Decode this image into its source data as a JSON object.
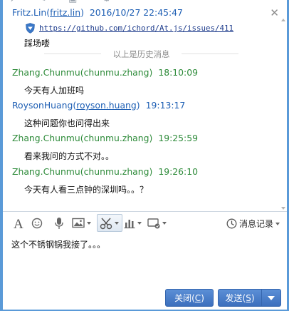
{
  "messages": [
    {
      "name": "Fritz.Lin",
      "open": "(",
      "handle": "fritz.lin",
      "close": ")",
      "time": "2016/10/27 22:45:47",
      "text": "踩场喽",
      "link": "https://github.com/ichord/At.js/issues/411",
      "color": "#1e5fb4"
    },
    {
      "name": "Zhang.Chunmu",
      "open": "(",
      "handle": "chunmu.zhang",
      "close": ")",
      "time": "18:10:09",
      "text": "今天有人加班吗",
      "color": "#2e8b3a"
    },
    {
      "name": "RoysonHuang",
      "open": "(",
      "handle": "royson.huang",
      "close": ")",
      "time": "19:13:17",
      "text": "这种问题你也问得出来",
      "color": "#1e5fb4"
    },
    {
      "name": "Zhang.Chunmu",
      "open": "(",
      "handle": "chunmu.zhang",
      "close": ")",
      "time": "19:25:59",
      "text": "看来我问的方式不对。。",
      "color": "#2e8b3a"
    },
    {
      "name": "Zhang.Chunmu",
      "open": "(",
      "handle": "chunmu.zhang",
      "close": ")",
      "time": "19:26:10",
      "text": "今天有人看三点钟的深圳吗。。？",
      "color": "#2e8b3a"
    }
  ],
  "history_divider": "以上是历史消息",
  "toolbar": {
    "history_label": "消息记录",
    "icons": [
      "font-icon",
      "emoji-icon",
      "voice-icon",
      "image-icon",
      "screenshot-icon",
      "chart-icon",
      "remote-icon"
    ]
  },
  "input": {
    "text": "这个不锈钢锅我接了。。。"
  },
  "buttons": {
    "close_label": "关闭(",
    "close_key": "C",
    "close_end": ")",
    "send_label": "发送(",
    "send_key": "S",
    "send_end": ")"
  },
  "colors": {
    "accent": "#3c6fbd",
    "frame": "#5a9ad8",
    "green_sender": "#2e8b3a",
    "blue_sender": "#1e5fb4"
  }
}
